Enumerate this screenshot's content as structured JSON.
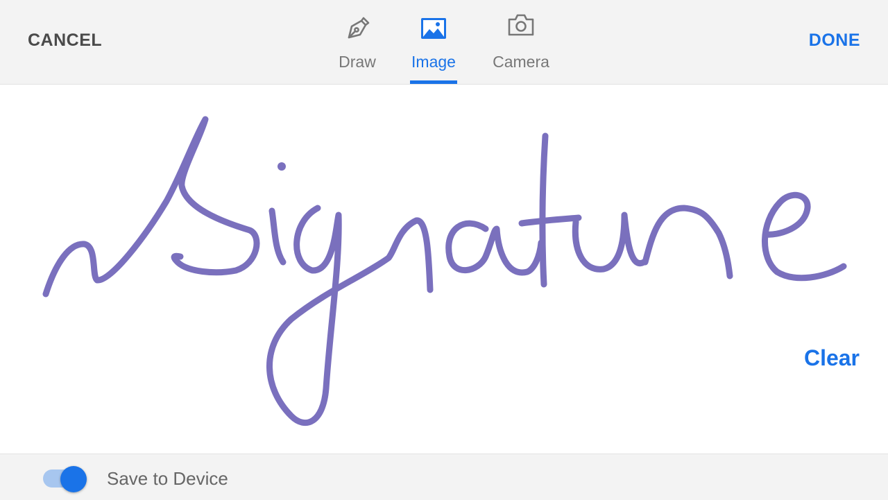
{
  "header": {
    "cancel_label": "CANCEL",
    "done_label": "DONE",
    "tabs": [
      {
        "label": "Draw",
        "icon": "pen-icon",
        "active": false
      },
      {
        "label": "Image",
        "icon": "image-icon",
        "active": true
      },
      {
        "label": "Camera",
        "icon": "camera-icon",
        "active": false
      }
    ]
  },
  "canvas": {
    "signature_text": "Signature",
    "clear_label": "Clear"
  },
  "footer": {
    "save_toggle_on": true,
    "save_label": "Save to Device"
  },
  "colors": {
    "accent": "#1a73e8",
    "ink": "#6f64b8",
    "inactive_text": "#777777"
  }
}
